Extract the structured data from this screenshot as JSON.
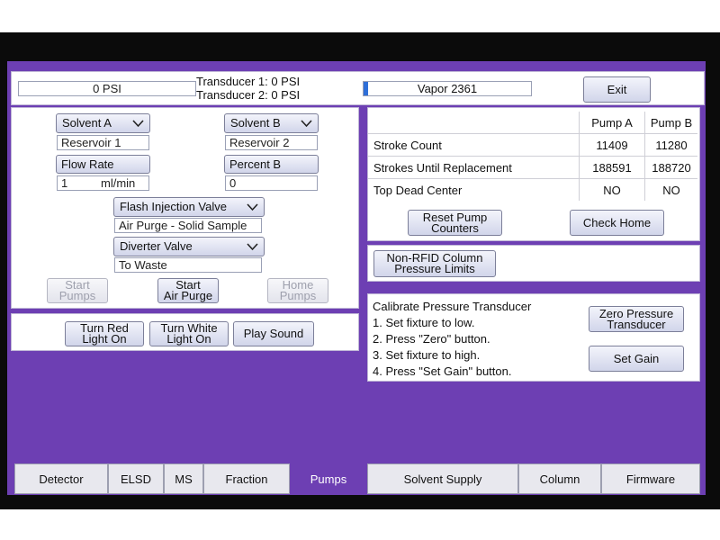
{
  "header": {
    "pressure": "0 PSI",
    "transducer1": "Transducer 1: 0 PSI",
    "transducer2": "Transducer 2: 0 PSI",
    "vapor_label": "Vapor 2361",
    "exit_label": "Exit"
  },
  "solvents": {
    "solvent_a_label": "Solvent A",
    "solvent_a_value": "Reservoir 1",
    "solvent_b_label": "Solvent B",
    "solvent_b_value": "Reservoir 2",
    "flow_rate_label": "Flow Rate",
    "flow_rate_value": "1",
    "flow_rate_unit": "ml/min",
    "percent_b_label": "Percent B",
    "percent_b_value": "0",
    "flash_valve_label": "Flash Injection Valve",
    "flash_valve_value": "Air Purge - Solid Sample",
    "diverter_label": "Diverter Valve",
    "diverter_value": "To Waste",
    "start_pumps_l1": "Start",
    "start_pumps_l2": "Pumps",
    "start_air_l1": "Start",
    "start_air_l2": "Air Purge",
    "home_pumps_l1": "Home",
    "home_pumps_l2": "Pumps"
  },
  "lights": {
    "red_l1": "Turn Red",
    "red_l2": "Light On",
    "white_l1": "Turn White",
    "white_l2": "Light On",
    "sound_label": "Play Sound"
  },
  "stats": {
    "col_a": "Pump A",
    "col_b": "Pump B",
    "rows": [
      {
        "label": "Stroke Count",
        "a": "11409",
        "b": "11280"
      },
      {
        "label": "Strokes Until Replacement",
        "a": "188591",
        "b": "188720"
      },
      {
        "label": "Top Dead Center",
        "a": "NO",
        "b": "NO"
      }
    ],
    "reset_l1": "Reset Pump",
    "reset_l2": "Counters",
    "check_home_label": "Check Home"
  },
  "limits": {
    "l1": "Non-RFID Column",
    "l2": "Pressure Limits"
  },
  "calibrate": {
    "title": "Calibrate Pressure Transducer",
    "step1": "1. Set fixture to low.",
    "step2": "2. Press \"Zero\" button.",
    "step3": "3. Set fixture to high.",
    "step4": "4. Press \"Set Gain\" button.",
    "zero_l1": "Zero Pressure",
    "zero_l2": "Transducer",
    "gain_label": "Set Gain"
  },
  "tabs": [
    "Detector",
    "ELSD",
    "MS",
    "Fraction",
    "Pumps",
    "Solvent Supply",
    "Column",
    "Firmware"
  ],
  "active_tab": "Pumps",
  "colors": {
    "background": "#6d3fb3",
    "accent": "#2f6fd8"
  }
}
